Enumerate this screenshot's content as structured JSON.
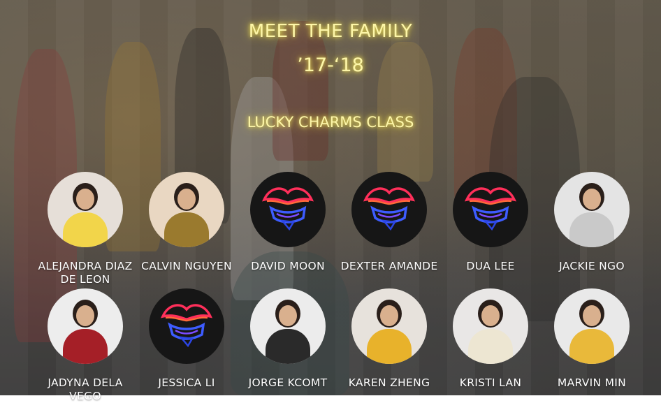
{
  "header": {
    "title": "MEET THE FAMILY",
    "year": "’17-‘18",
    "class_name": "LUCKY CHARMS CLASS"
  },
  "members": [
    {
      "name": "ALEJANDRA DIAZ DE LEON",
      "avatar": "photo",
      "bg": "#e6dfd8",
      "shirt": "#f2d54a"
    },
    {
      "name": "CALVIN NGUYEN",
      "avatar": "photo",
      "bg": "#e9d7c2",
      "shirt": "#9a7a2e"
    },
    {
      "name": "DAVID MOON",
      "avatar": "logo"
    },
    {
      "name": "DEXTER AMANDE",
      "avatar": "logo"
    },
    {
      "name": "DUA LEE",
      "avatar": "logo"
    },
    {
      "name": "JACKIE NGO",
      "avatar": "photo",
      "bg": "#e4e4e4",
      "shirt": "#c9c9c9"
    },
    {
      "name": "JADYNA DELA VEGO",
      "avatar": "photo",
      "bg": "#ededed",
      "shirt": "#a51f27"
    },
    {
      "name": "JESSICA LI",
      "avatar": "logo"
    },
    {
      "name": "JORGE KCOMT",
      "avatar": "photo",
      "bg": "#ececec",
      "shirt": "#2a2a2a"
    },
    {
      "name": "KAREN ZHENG",
      "avatar": "photo",
      "bg": "#e7e2dc",
      "shirt": "#e8b22b"
    },
    {
      "name": "KRISTI LAN",
      "avatar": "photo",
      "bg": "#e9e7e6",
      "shirt": "#ede6d2"
    },
    {
      "name": "MARVIN MIN",
      "avatar": "photo",
      "bg": "#e9e9e9",
      "shirt": "#e9b93a"
    }
  ]
}
